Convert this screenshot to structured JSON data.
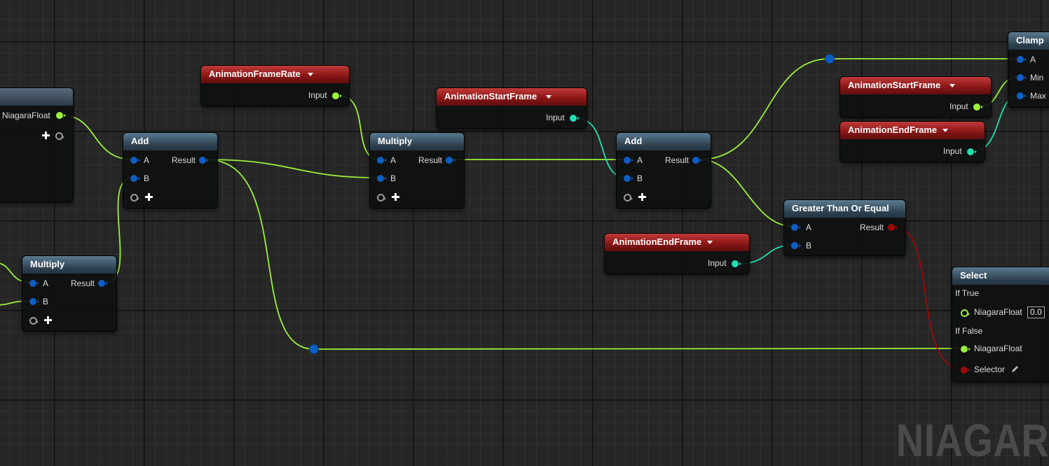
{
  "graph": {
    "watermark": "NIAGARA",
    "nodes": {
      "partial_left": {
        "output_label": "NiagaraFloat"
      },
      "add_1": {
        "title": "Add",
        "pin_a": "A",
        "pin_b": "B",
        "result": "Result"
      },
      "multiply_1": {
        "title": "Multiply",
        "pin_a": "A",
        "pin_b": "B",
        "result": "Result"
      },
      "frame_rate_param": {
        "title": "AnimationFrameRate",
        "output": "Input"
      },
      "multiply_2": {
        "title": "Multiply",
        "pin_a": "A",
        "pin_b": "B",
        "result": "Result"
      },
      "start_frame_param_1": {
        "title": "AnimationStartFrame",
        "output": "Input"
      },
      "add_2": {
        "title": "Add",
        "pin_a": "A",
        "pin_b": "B",
        "result": "Result"
      },
      "end_frame_param_1": {
        "title": "AnimationEndFrame",
        "output": "Input"
      },
      "greater_equal": {
        "title": "Greater Than Or Equal",
        "pin_a": "A",
        "pin_b": "B",
        "result": "Result"
      },
      "start_frame_param_2": {
        "title": "AnimationStartFrame",
        "output": "Input"
      },
      "end_frame_param_2": {
        "title": "AnimationEndFrame",
        "output": "Input"
      },
      "clamp": {
        "title": "Clamp",
        "pin_a": "A",
        "pin_min": "Min",
        "pin_max": "Max"
      },
      "select": {
        "title": "Select",
        "if_true": "If True",
        "true_input": "NiagaraFloat",
        "true_value": "0.0",
        "if_false": "If False",
        "false_input": "NiagaraFloat",
        "selector": "Selector"
      }
    },
    "colors": {
      "float_wire": "#9bf13a",
      "teal_wire": "#1fe0b0",
      "bool_wire": "#a00808",
      "generic_pin": "#0e5ec4"
    }
  }
}
